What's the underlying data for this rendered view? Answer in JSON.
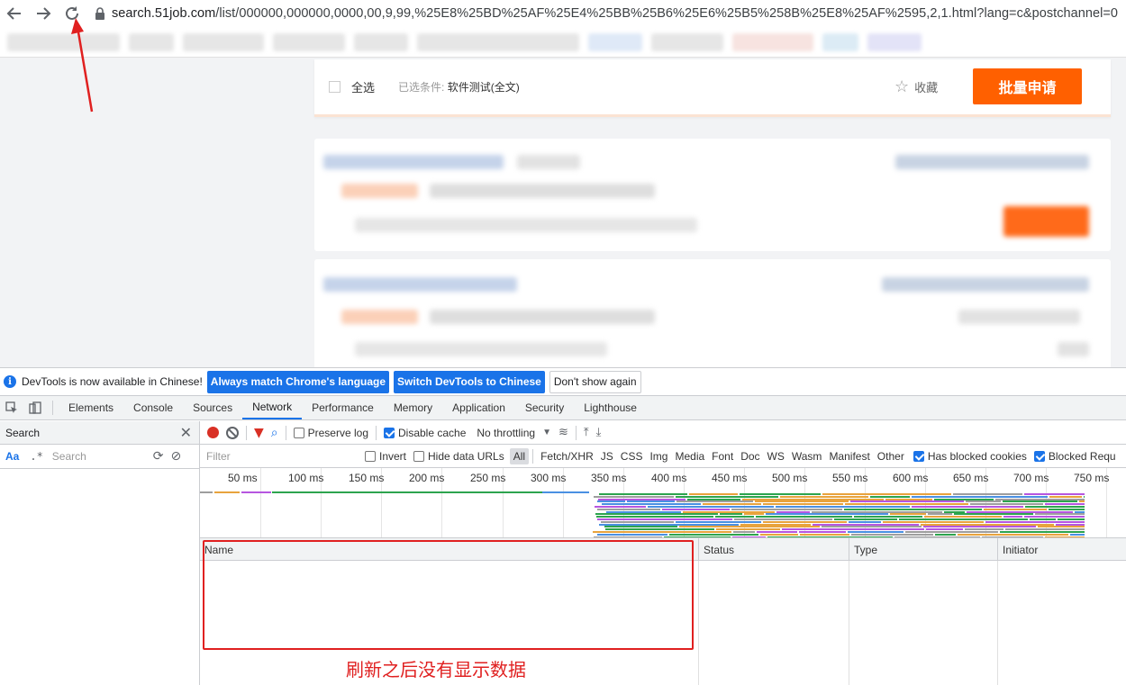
{
  "browser": {
    "url_host": "search.51job.com",
    "url_path": "/list/000000,000000,0000,00,9,99,%25E8%25BD%25AF%25E4%25BB%25B6%25E6%25B5%258B%25E8%25AF%2595,2,1.html?lang=c&postchannel=0",
    "icons": [
      "back-icon",
      "forward-icon",
      "reload-icon",
      "lock-icon"
    ]
  },
  "page": {
    "select_all": "全选",
    "condition_label": "已选条件:",
    "condition_value": "软件测试(全文)",
    "favorite": "收藏",
    "apply_button": "批量申请",
    "accent": "#ff6000"
  },
  "devtools": {
    "info_text": "DevTools is now available in Chinese!",
    "btn_match": "Always match Chrome's language",
    "btn_switch": "Switch DevTools to Chinese",
    "btn_dismiss": "Don't show again",
    "tabs": [
      "Elements",
      "Console",
      "Sources",
      "Network",
      "Performance",
      "Memory",
      "Application",
      "Security",
      "Lighthouse"
    ],
    "active_tab": "Network",
    "search_pane": {
      "title": "Search",
      "aa": "Aa",
      "regex": ".*",
      "placeholder": "Search"
    },
    "toolbar": {
      "preserve_log": "Preserve log",
      "disable_cache": "Disable cache",
      "throttling": "No throttling"
    },
    "filter": {
      "placeholder": "Filter",
      "invert": "Invert",
      "hide_data_urls": "Hide data URLs",
      "types": [
        "All",
        "Fetch/XHR",
        "JS",
        "CSS",
        "Img",
        "Media",
        "Font",
        "Doc",
        "WS",
        "Wasm",
        "Manifest",
        "Other"
      ],
      "has_blocked_cookies": "Has blocked cookies",
      "blocked_requests": "Blocked Requ"
    },
    "timeline_ticks": [
      "50 ms",
      "100 ms",
      "150 ms",
      "200 ms",
      "250 ms",
      "300 ms",
      "350 ms",
      "400 ms",
      "450 ms",
      "500 ms",
      "550 ms",
      "600 ms",
      "650 ms",
      "700 ms",
      "750 ms"
    ],
    "columns": [
      "Name",
      "Status",
      "Type",
      "Initiator"
    ]
  },
  "annotation": {
    "note": "刷新之后没有显示数据",
    "color": "#e02020"
  }
}
